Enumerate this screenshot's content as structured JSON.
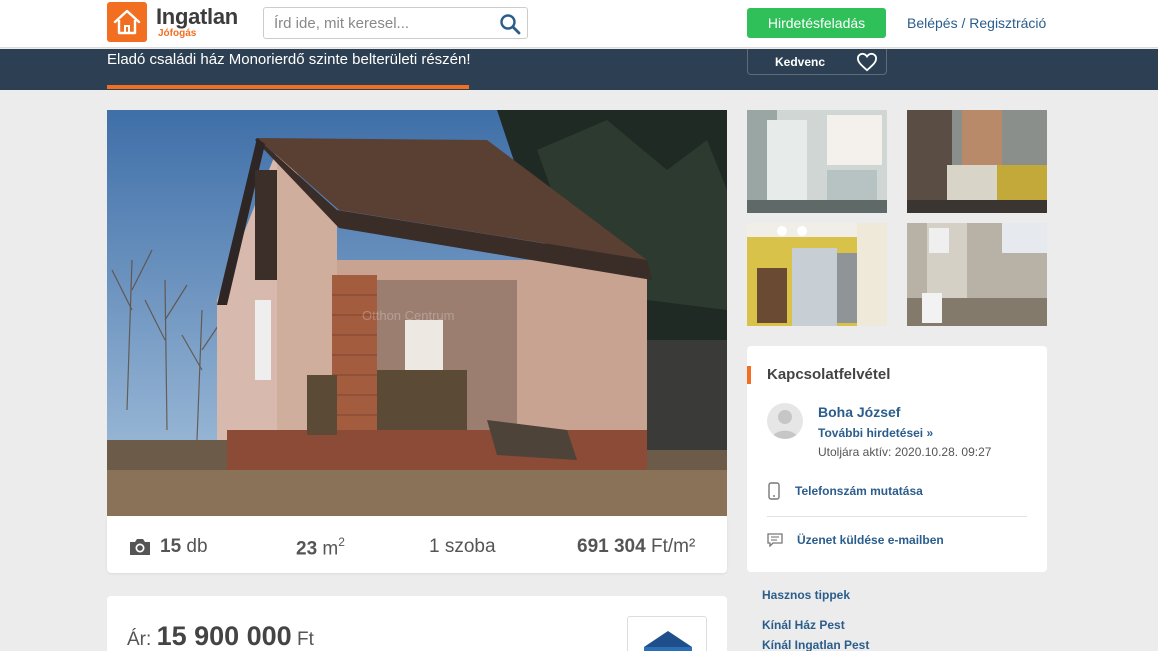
{
  "header": {
    "logo_main": "Ingatlan",
    "logo_sub": "Jófogás",
    "search_placeholder": "Írd ide, mit keresel...",
    "post_button": "Hirdetésfeladás",
    "login": "Belépés",
    "separator": "/",
    "register": "Regisztráció"
  },
  "listing": {
    "title": "Eladó családi ház Monorierdő szinte belterületi részén!",
    "favorite_label": "Kedvenc",
    "watermark": "Otthon Centrum",
    "stats": {
      "photo_count": "15",
      "photo_unit": "db",
      "area_value": "23",
      "area_unit": "m",
      "area_sup": "2",
      "rooms": "1 szoba",
      "price_per_sqm_value": "691 304",
      "price_per_sqm_unit": "Ft/m²"
    },
    "price_label": "Ár:",
    "price_value": "15 900 000",
    "price_currency": "Ft"
  },
  "contact": {
    "title": "Kapcsolatfelvétel",
    "seller_name": "Boha József",
    "more_ads": "További hirdetései »",
    "last_active": "Utoljára aktív: 2020.10.28. 09:27",
    "show_phone": "Telefonszám mutatása",
    "send_email": "Üzenet küldése e-mailben"
  },
  "side_links": {
    "tips": "Hasznos tippek",
    "offer_house": "Kínál Ház Pest",
    "offer_property": "Kínál Ingatlan Pest"
  },
  "colors": {
    "brand_orange": "#f26f21",
    "header_band": "#2d4053",
    "post_green": "#2fc05a",
    "link_blue": "#2b5d8c"
  }
}
